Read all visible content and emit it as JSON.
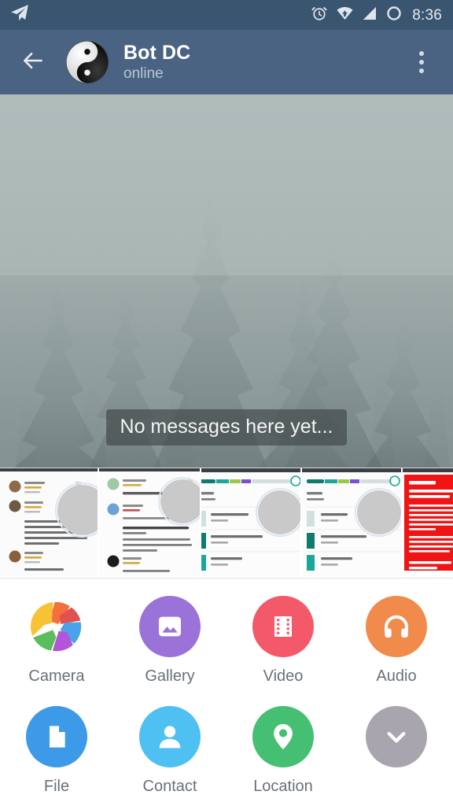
{
  "statusbar": {
    "app_icon": "telegram-paper-plane-icon",
    "icons": [
      "alarm-clock-icon",
      "wifi-icon",
      "cellular-signal-icon",
      "battery-circle-icon"
    ],
    "time": "8:36",
    "time_color": "#e8ecf0",
    "background": "#3a5570"
  },
  "appbar": {
    "background": "#4b6382",
    "back_icon": "back-arrow-icon",
    "avatar_icon": "yin-yang-avatar",
    "title": "Bot DC",
    "status": "online",
    "title_color": "#ffffff",
    "status_color": "#b9c6d6",
    "menu_icon": "overflow-menu-icon"
  },
  "chat": {
    "wallpaper": "foggy-pine-forest",
    "empty_message": "No messages here yet...",
    "empty_bubble_bg": "rgba(60,66,68,0.62)"
  },
  "photo_strip": {
    "items": [
      {
        "name": "screenshot-app-reviews-1",
        "kind": "recent-photo"
      },
      {
        "name": "screenshot-app-reviews-2",
        "kind": "recent-photo"
      },
      {
        "name": "screenshot-storage-usage-1",
        "kind": "recent-photo"
      },
      {
        "name": "screenshot-storage-usage-2",
        "kind": "recent-photo"
      },
      {
        "name": "screenshot-red-warning-page",
        "kind": "recent-photo"
      }
    ]
  },
  "attach_panel": {
    "background": "#ffffff",
    "label_color": "#69707a",
    "rows": [
      [
        {
          "label": "Camera",
          "icon": "camera-aperture-icon",
          "color": "#ffffff",
          "aperture_colors": [
            "#f3703a",
            "#e05252",
            "#4aa3e8",
            "#b255d6",
            "#5cbd5c",
            "#f7c335"
          ]
        },
        {
          "label": "Gallery",
          "icon": "gallery-photo-icon",
          "color": "#9b72d8"
        },
        {
          "label": "Video",
          "icon": "video-filmstrip-icon",
          "color": "#f4596a"
        },
        {
          "label": "Audio",
          "icon": "audio-headphones-icon",
          "color": "#f08b4c"
        }
      ],
      [
        {
          "label": "File",
          "icon": "file-document-icon",
          "color": "#3d9ae8"
        },
        {
          "label": "Contact",
          "icon": "contact-person-icon",
          "color": "#4ec1f2"
        },
        {
          "label": "Location",
          "icon": "location-pin-icon",
          "color": "#45bf71"
        },
        {
          "label": "",
          "icon": "chevron-down-icon",
          "color": "#a9a5ae"
        }
      ]
    ]
  }
}
